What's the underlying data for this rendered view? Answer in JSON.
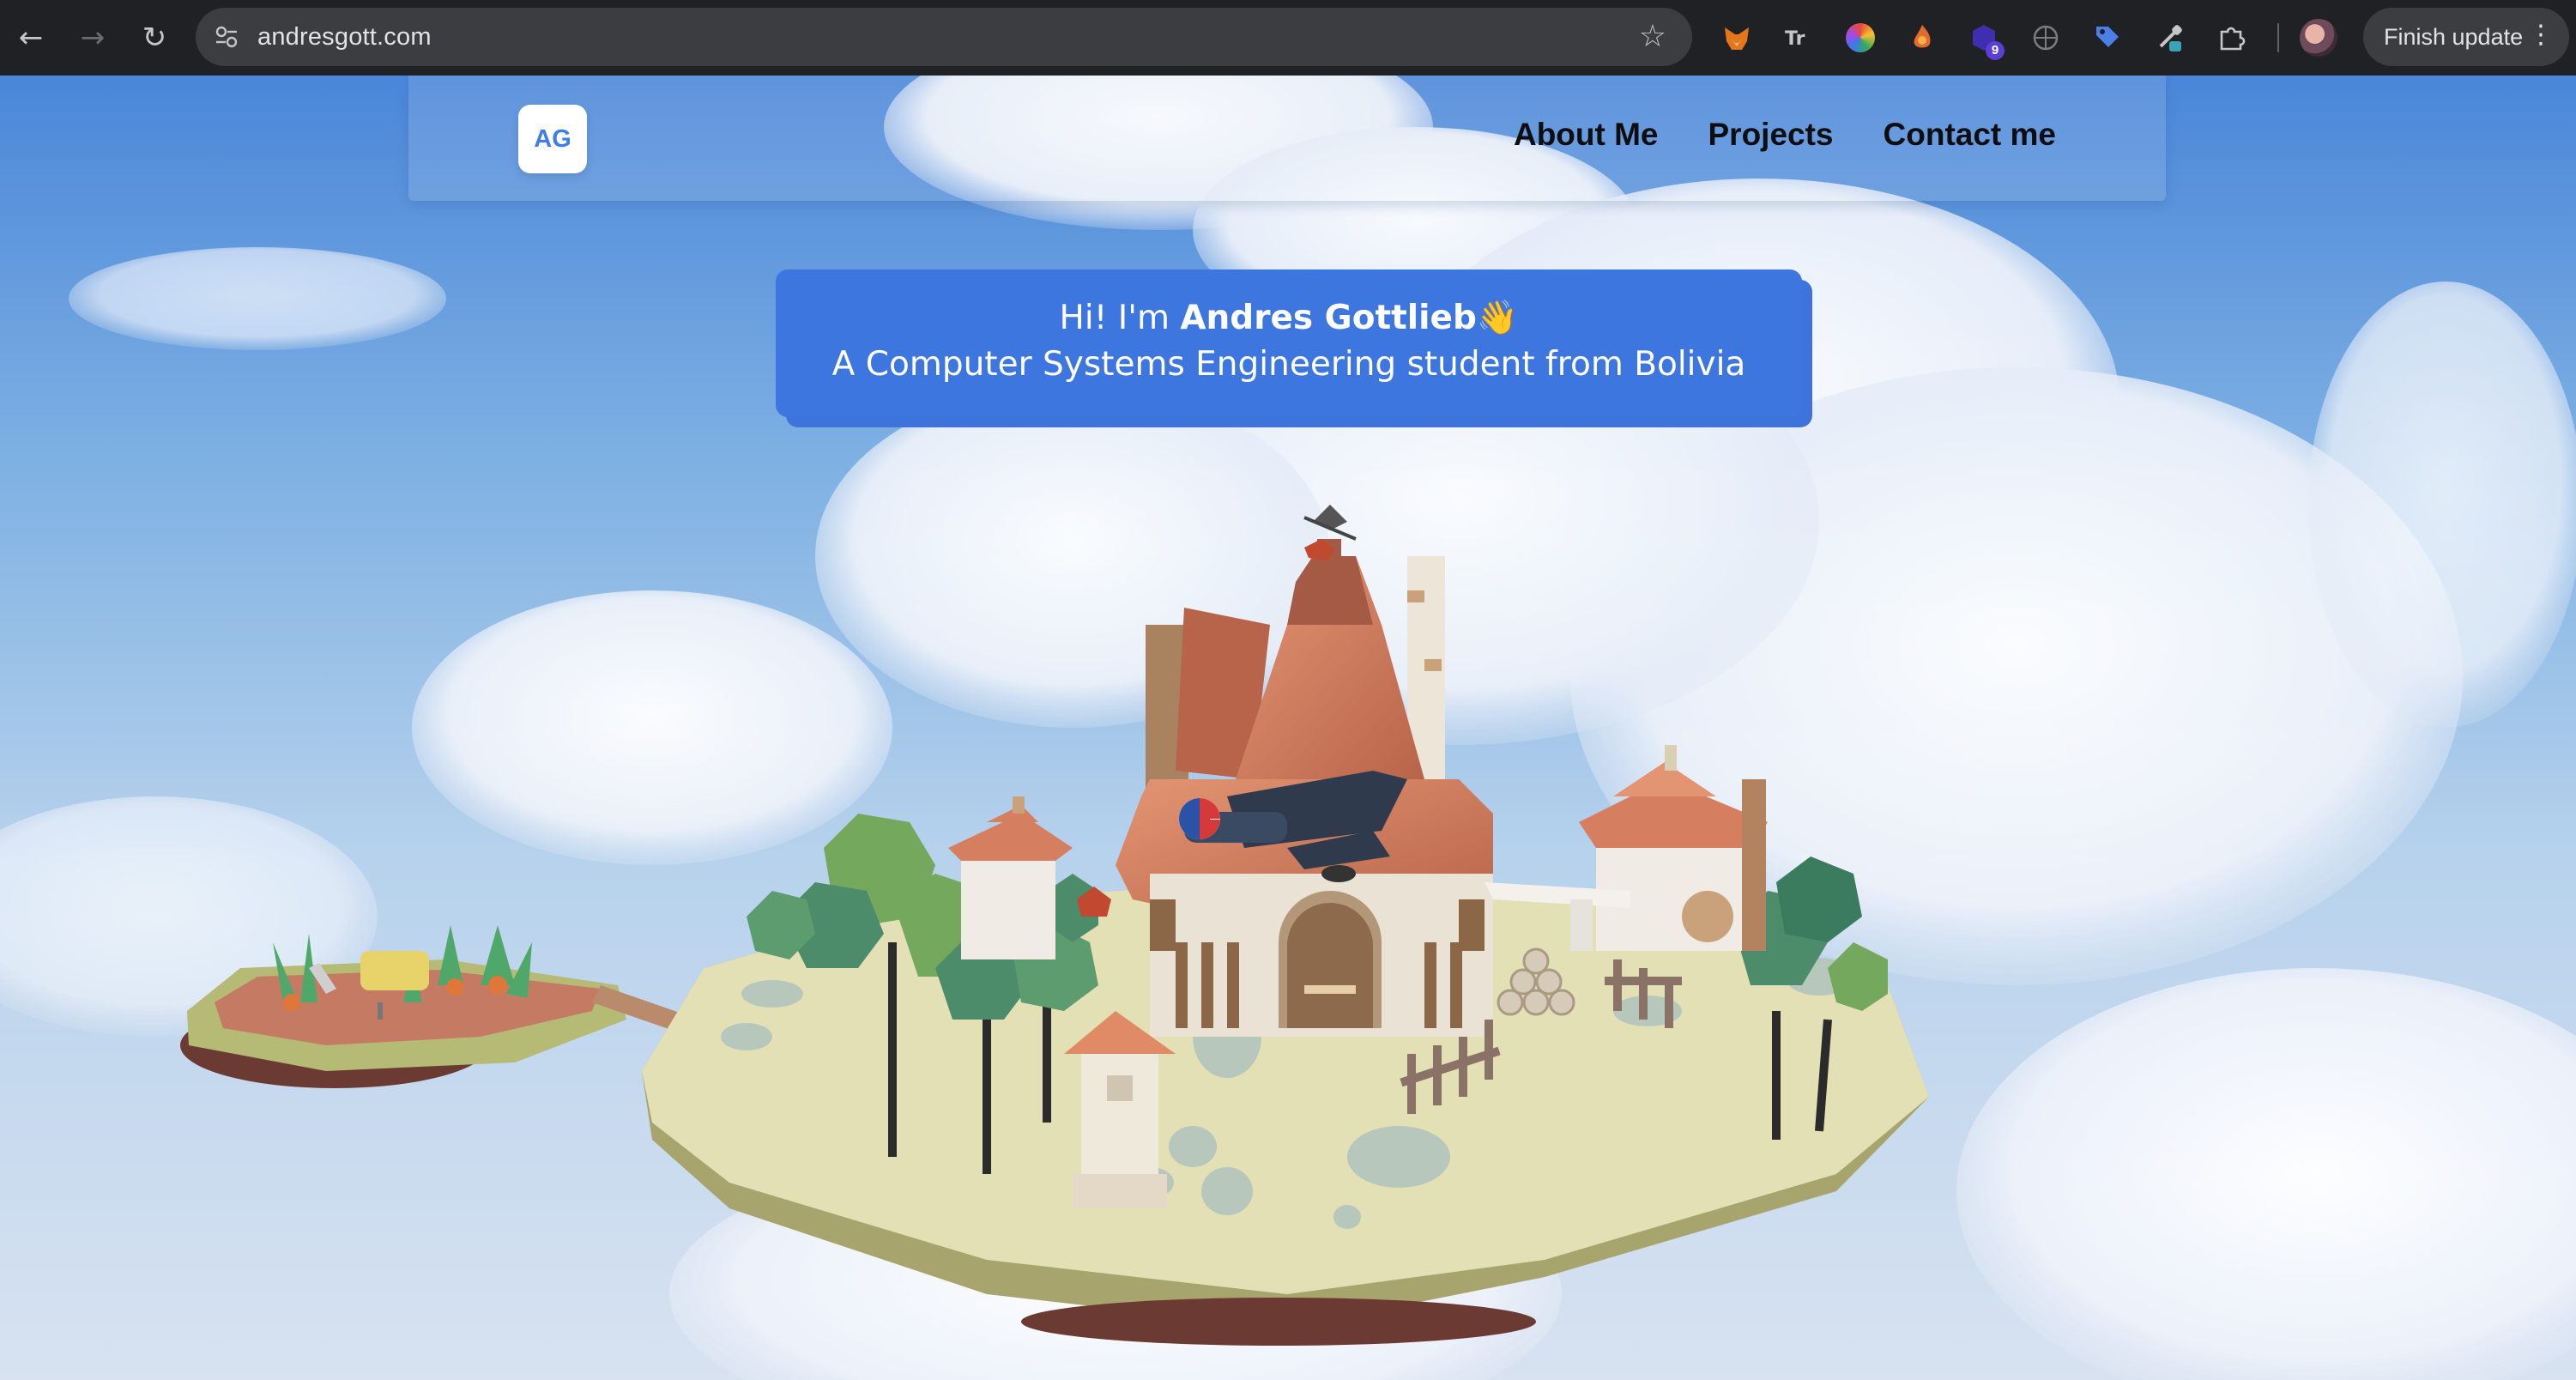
{
  "browser": {
    "url": "andresgott.com",
    "update_button_label": "Finish update",
    "nav_icons": [
      "back-arrow-icon",
      "forward-arrow-icon",
      "reload-icon"
    ],
    "extensions": [
      {
        "name": "metamask-fox-icon",
        "color": "#e2761b"
      },
      {
        "name": "translate-icon",
        "color": "#c4c7c5"
      },
      {
        "name": "color-picker-icon",
        "color": "#e8a12a"
      },
      {
        "name": "flame-extension-icon",
        "color": "#e26a2c"
      },
      {
        "name": "hexagon-extension-icon",
        "color": "#5b3fd4",
        "badge": "9"
      },
      {
        "name": "web-extension-icon",
        "color": "#7a7d80"
      },
      {
        "name": "tag-extension-icon",
        "color": "#4a7ee8"
      },
      {
        "name": "eyedropper-extension-icon",
        "color": "#c4c7c5"
      },
      {
        "name": "puzzle-extensions-icon",
        "color": "#c4c7c5"
      }
    ]
  },
  "site": {
    "logo_text": "AG",
    "nav": [
      "About Me",
      "Projects",
      "Contact me"
    ],
    "intro": {
      "greeting_prefix": "Hi! I'm ",
      "name": "Andres Gottlieb",
      "emoji": "👋",
      "subtitle": "A Computer Systems Engineering student from Bolivia"
    }
  },
  "colors": {
    "accent": "#3e76e0",
    "chrome_bg": "#202124",
    "sky_top": "#4a86d9",
    "island_grass": "#e2e0b4"
  }
}
